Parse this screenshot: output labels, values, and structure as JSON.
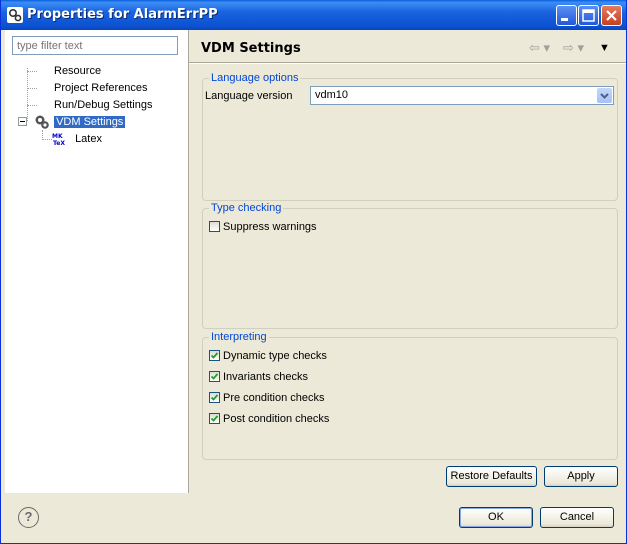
{
  "window": {
    "title": "Properties for AlarmErrPP"
  },
  "filter": {
    "placeholder": "type filter text"
  },
  "tree": {
    "items": [
      {
        "label": "Resource"
      },
      {
        "label": "Project References"
      },
      {
        "label": "Run/Debug Settings"
      },
      {
        "label": "VDM Settings",
        "selected": true
      },
      {
        "label": "Latex"
      }
    ]
  },
  "page": {
    "title": "VDM Settings",
    "language_options": {
      "legend": "Language options",
      "version_label": "Language version",
      "version_value": "vdm10"
    },
    "type_checking": {
      "legend": "Type checking",
      "suppress_warnings": {
        "label": "Suppress warnings",
        "checked": false
      }
    },
    "interpreting": {
      "legend": "Interpreting",
      "options": [
        {
          "label": "Dynamic type checks",
          "checked": true
        },
        {
          "label": "Invariants checks",
          "checked": true
        },
        {
          "label": "Pre condition checks",
          "checked": true
        },
        {
          "label": "Post condition checks",
          "checked": true
        }
      ]
    },
    "restore_defaults": "Restore Defaults",
    "apply": "Apply"
  },
  "footer": {
    "help": "?",
    "ok": "OK",
    "cancel": "Cancel"
  },
  "colors": {
    "accent": "#316ac5",
    "legend": "#0046d5",
    "titlebar": "#0b50d0"
  }
}
